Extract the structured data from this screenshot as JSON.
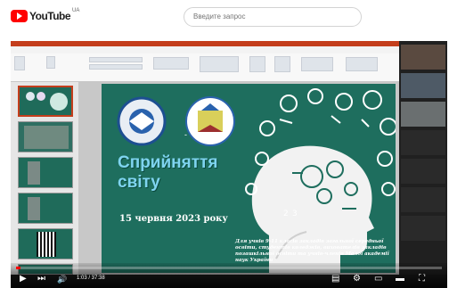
{
  "header": {
    "logo_text": "YouTube",
    "country_code": "UA",
    "search_placeholder": "Введите запрос"
  },
  "video": {
    "progress_fraction": 0.01,
    "current_time": "1:03",
    "duration": "37:38",
    "time_display": "1:03 / 37:38"
  },
  "slide": {
    "title_line1": "Сприйняття",
    "title_line2": "світу",
    "dash": "-",
    "date": "15 червня 2023 року",
    "note": "Для учнів 9-11 класів закладів загальної середньої освіти, студентів коледжів, вихователів закладів позашкільної освіти та учнів-членів Малої академії наук України",
    "logo_left_text": "МТМАОВ",
    "logo_right_text": "МАН",
    "bg_color": "#1e6e5e",
    "title_color": "#7fd4f0"
  },
  "icons": {
    "play": "▶",
    "next": "⏭",
    "volume": "🔊",
    "settings": "⚙",
    "miniplayer": "▭",
    "theater": "▬",
    "fullscreen": "⛶",
    "subtitles": "▤"
  },
  "accent": "#ff0000"
}
